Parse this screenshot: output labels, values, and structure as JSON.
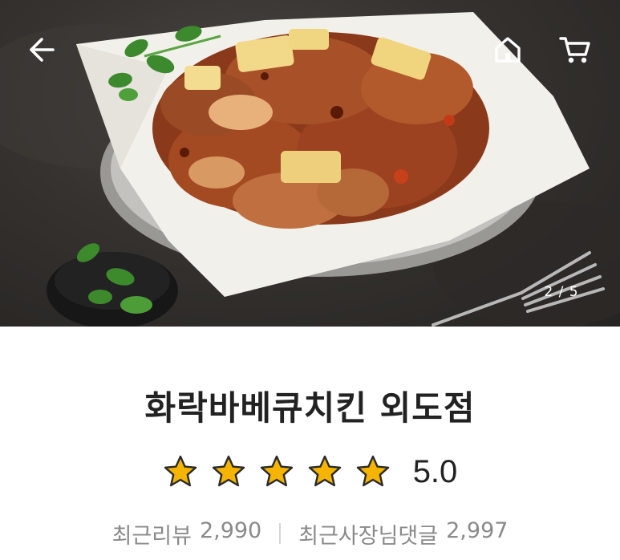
{
  "hero": {
    "page_indicator": "2 / 5",
    "icons": {
      "back": "arrow-left-icon",
      "home": "home-icon",
      "cart": "cart-icon"
    }
  },
  "store": {
    "name": "화락바베큐치킨 외도점",
    "rating": {
      "value": "5.0",
      "stars": 5,
      "filled": 5,
      "star_color": "#f5b400"
    },
    "recent_reviews_label": "최근리뷰",
    "recent_reviews_count": "2,990",
    "owner_replies_label": "최근사장님댓글",
    "owner_replies_count": "2,997"
  },
  "colors": {
    "text_primary": "#222222",
    "text_secondary": "#8a8a8a",
    "background": "#ffffff"
  }
}
